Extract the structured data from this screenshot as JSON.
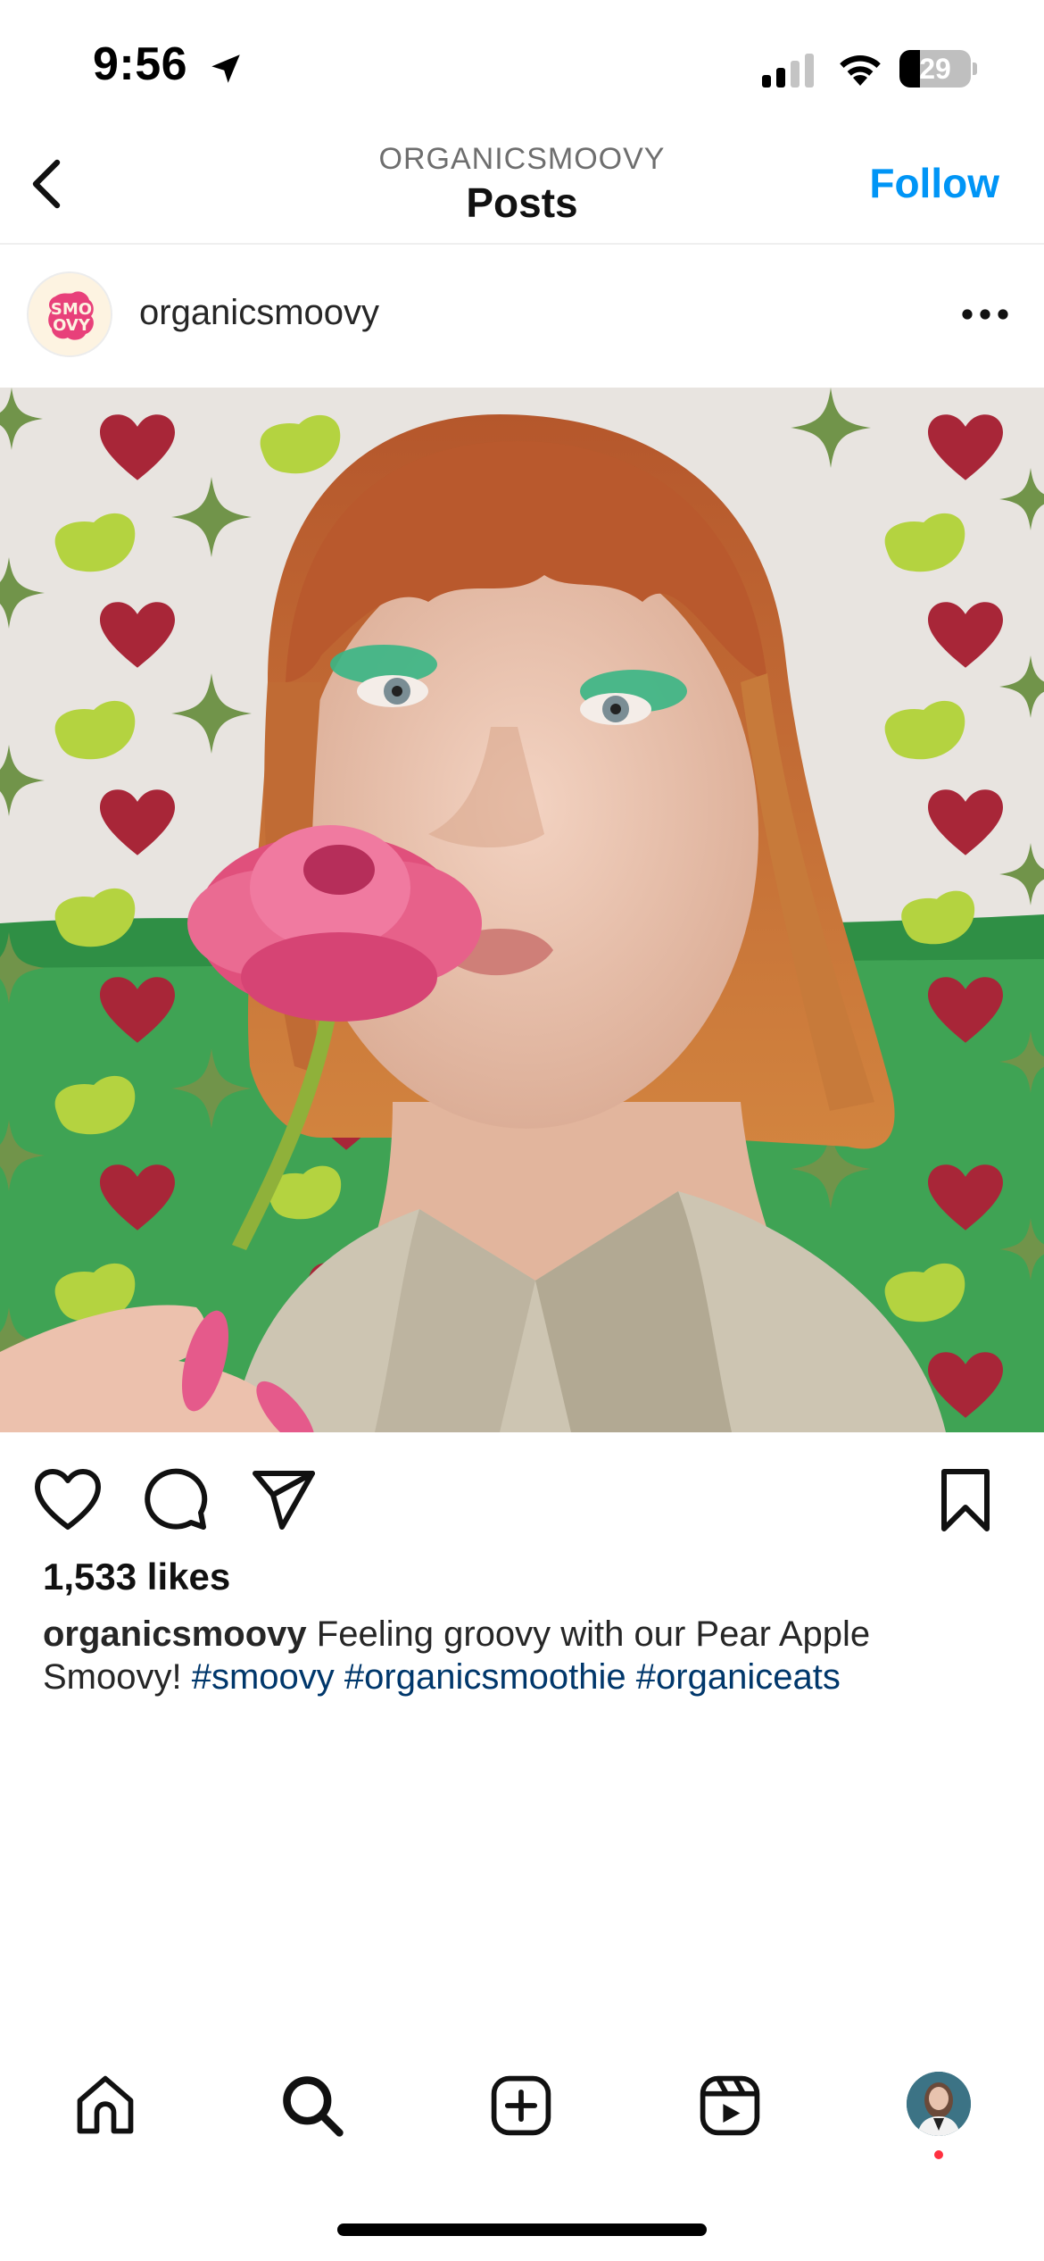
{
  "status_bar": {
    "time": "9:56",
    "battery_level": "29",
    "battery_fraction": 0.29
  },
  "header": {
    "account": "ORGANICSMOOVY",
    "title": "Posts",
    "follow_label": "Follow"
  },
  "post": {
    "username": "organicsmoovy",
    "avatar_logo_text": "SMO OVY",
    "likes": "1,533 likes",
    "caption": {
      "username": "organicsmoovy",
      "text": "Feeling groovy with our Pear Apple Smoovy!",
      "hashtags": [
        "#smoovy",
        "#organicsmoothie",
        "#organiceats"
      ]
    }
  },
  "icons": {
    "status": [
      "location-arrow-icon",
      "cellular-signal-icon",
      "wifi-icon",
      "battery-icon"
    ],
    "header": [
      "back-arrow-icon",
      "more-options-icon"
    ],
    "actions": [
      "heart-icon",
      "comment-icon",
      "share-icon",
      "bookmark-icon"
    ],
    "tabs": [
      "home-icon",
      "search-icon",
      "create-post-icon",
      "reels-icon",
      "profile-avatar"
    ]
  },
  "colors": {
    "accent": "#0095f6",
    "hashtag": "#00376b",
    "notification_dot": "#ff3040"
  }
}
